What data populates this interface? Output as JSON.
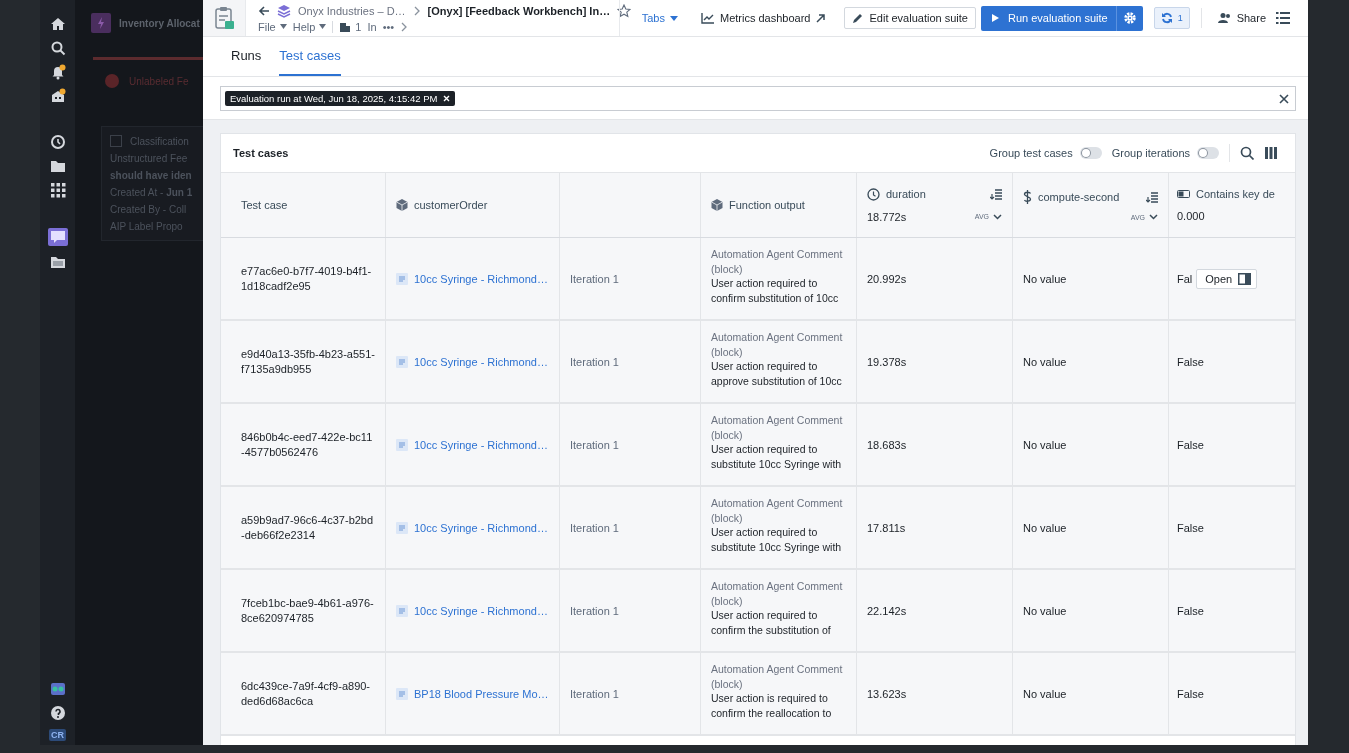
{
  "background_app": {
    "title": "Inventory Allocat",
    "alert": "Unlabeled Fe",
    "card": {
      "title": "Classification",
      "checked": false,
      "lines": [
        "Unstructured Fee",
        "**should have iden**",
        "Created At - **Jun 1**",
        "Created By - Coll",
        "AIP Label Propo"
      ]
    }
  },
  "rail": {
    "avatar": "CR"
  },
  "header": {
    "breadcrumb": "Onyx Industries – D…",
    "title": "[Onyx] [Feedback Workbench] In…",
    "starred": false,
    "menus": [
      "File",
      "Help"
    ],
    "count": "1",
    "tail": "In",
    "more": "•••",
    "tabs_menu": "Tabs",
    "metrics": "Metrics dashboard",
    "edit": "Edit evaluation suite",
    "run": "Run evaluation suite",
    "sync_count": "1",
    "share": "Share"
  },
  "tabs": [
    {
      "label": "Runs",
      "selected": false
    },
    {
      "label": "Test cases",
      "selected": true
    }
  ],
  "filter": {
    "chip": "Evaluation run at Wed, Jun 18, 2025, 4:15:42 PM"
  },
  "card": {
    "title": "Test cases",
    "toggles": [
      {
        "label": "Group test cases",
        "on": false
      },
      {
        "label": "Group iterations",
        "on": false
      }
    ],
    "columns": [
      {
        "kind": "text",
        "label": "Test case"
      },
      {
        "kind": "object",
        "label": "customerOrder"
      },
      {
        "kind": "blank"
      },
      {
        "kind": "object",
        "label": "Function output"
      },
      {
        "kind": "duration",
        "label": "duration",
        "summary": "18.772s",
        "aggregate": "AVG"
      },
      {
        "kind": "cost",
        "label": "compute-second",
        "aggregate": "AVG"
      },
      {
        "kind": "boolean",
        "label": "Contains key de",
        "summary": "0.000"
      }
    ],
    "rows": [
      {
        "test_case": "e77ac6e0-b7f7-4019-b4f1-1d18cadf2e95",
        "order": "10cc Syringe - Richmond…",
        "iteration": "Iteration 1",
        "output_label": "Automation Agent Comment (block)",
        "output_text": "User action required to confirm substitution of 10cc",
        "duration": "20.992s",
        "compute": "No value",
        "contains": "Fal",
        "action": "Open"
      },
      {
        "test_case": "e9d40a13-35fb-4b23-a551-f7135a9db955",
        "order": "10cc Syringe - Richmond…",
        "iteration": "Iteration 1",
        "output_label": "Automation Agent Comment (block)",
        "output_text": "User action required to approve substitution of 10cc",
        "duration": "19.378s",
        "compute": "No value",
        "contains": "False"
      },
      {
        "test_case": "846b0b4c-eed7-422e-bc11-4577b0562476",
        "order": "10cc Syringe - Richmond…",
        "iteration": "Iteration 1",
        "output_label": "Automation Agent Comment (block)",
        "output_text": "User action required to substitute 10cc Syringe with",
        "duration": "18.683s",
        "compute": "No value",
        "contains": "False"
      },
      {
        "test_case": "a59b9ad7-96c6-4c37-b2bd-deb66f2e2314",
        "order": "10cc Syringe - Richmond…",
        "iteration": "Iteration 1",
        "output_label": "Automation Agent Comment (block)",
        "output_text": "User action required to substitute 10cc Syringe with",
        "duration": "17.811s",
        "compute": "No value",
        "contains": "False"
      },
      {
        "test_case": "7fceb1bc-bae9-4b61-a976-8ce620974785",
        "order": "10cc Syringe - Richmond…",
        "iteration": "Iteration 1",
        "output_label": "Automation Agent Comment (block)",
        "output_text": "User action required to confirm the substitution of",
        "duration": "22.142s",
        "compute": "No value",
        "contains": "False"
      },
      {
        "test_case": "6dc439ce-7a9f-4cf9-a890-ded6d68ac6ca",
        "order": "BP18 Blood Pressure Mo…",
        "iteration": "Iteration 1",
        "output_label": "Automation Agent Comment (block)",
        "output_text": "User action is required to confirm the reallocation to",
        "duration": "13.623s",
        "compute": "No value",
        "contains": "False"
      }
    ]
  }
}
